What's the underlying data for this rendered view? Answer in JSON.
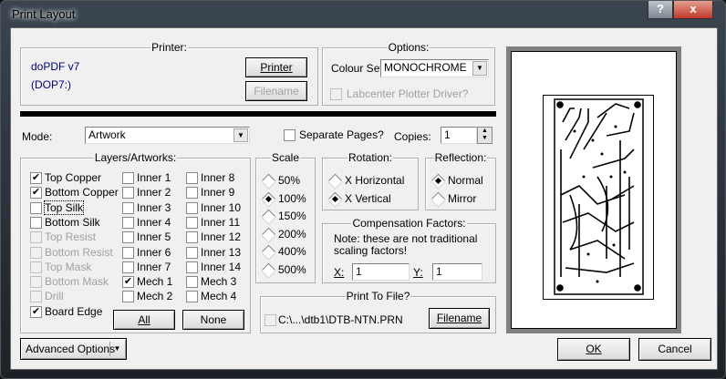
{
  "window": {
    "title": "Print Layout",
    "help": "?",
    "close": "x"
  },
  "printer": {
    "group": "Printer:",
    "name": "doPDF v7",
    "port": "(DOP7:)",
    "printer_btn": "Printer",
    "filename_btn": "Filename"
  },
  "options": {
    "group": "Options:",
    "colour_label": "Colour Set:",
    "colour_value": "MONOCHROME",
    "plotter_label": "Labcenter Plotter Driver?"
  },
  "mode": {
    "label": "Mode:",
    "value": "Artwork",
    "separate_label": "Separate Pages?",
    "copies_label": "Copies:",
    "copies_value": "1"
  },
  "layers": {
    "group": "Layers/Artworks:",
    "items": [
      {
        "label": "Top Copper",
        "checked": true,
        "disabled": false
      },
      {
        "label": "Bottom Copper",
        "checked": true,
        "disabled": false
      },
      {
        "label": "Top Silk",
        "checked": false,
        "disabled": false
      },
      {
        "label": "Bottom Silk",
        "checked": false,
        "disabled": false
      },
      {
        "label": "Top Resist",
        "checked": false,
        "disabled": true
      },
      {
        "label": "Bottom Resist",
        "checked": false,
        "disabled": true
      },
      {
        "label": "Top Mask",
        "checked": false,
        "disabled": true
      },
      {
        "label": "Bottom Mask",
        "checked": false,
        "disabled": true
      },
      {
        "label": "Drill",
        "checked": false,
        "disabled": true
      },
      {
        "label": "Board Edge",
        "checked": true,
        "disabled": false
      },
      {
        "label": "Inner 1",
        "checked": false
      },
      {
        "label": "Inner 2",
        "checked": false
      },
      {
        "label": "Inner 3",
        "checked": false
      },
      {
        "label": "Inner 4",
        "checked": false
      },
      {
        "label": "Inner 5",
        "checked": false
      },
      {
        "label": "Inner 6",
        "checked": false
      },
      {
        "label": "Inner 7",
        "checked": false
      },
      {
        "label": "Mech 1",
        "checked": true
      },
      {
        "label": "Mech 2",
        "checked": false
      },
      {
        "label": "Inner 8",
        "checked": false
      },
      {
        "label": "Inner 9",
        "checked": false
      },
      {
        "label": "Inner 10",
        "checked": false
      },
      {
        "label": "Inner 11",
        "checked": false
      },
      {
        "label": "Inner 12",
        "checked": false
      },
      {
        "label": "Inner 13",
        "checked": false
      },
      {
        "label": "Inner 14",
        "checked": false
      },
      {
        "label": "Mech 3",
        "checked": false
      },
      {
        "label": "Mech 4",
        "checked": false
      }
    ],
    "all_btn": "All",
    "none_btn": "None"
  },
  "scale": {
    "group": "Scale",
    "options": [
      "50%",
      "100%",
      "150%",
      "200%",
      "400%",
      "500%"
    ],
    "selected": "100%"
  },
  "rotation": {
    "group": "Rotation:",
    "options": [
      "X Horizontal",
      "X Vertical"
    ],
    "selected": "X Vertical"
  },
  "reflection": {
    "group": "Reflection:",
    "options": [
      "Normal",
      "Mirror"
    ],
    "selected": "Normal"
  },
  "compensation": {
    "group": "Compensation Factors:",
    "note1": "Note: these are not traditional",
    "note2": "scaling factors!",
    "x_label": "X:",
    "x_value": "1",
    "y_label": "Y:",
    "y_value": "1"
  },
  "print_to_file": {
    "group": "Print To File?",
    "path": "C:\\...\\dtb1\\DTB-NTN.PRN",
    "filename_btn": "Filename"
  },
  "footer": {
    "advanced": "Advanced Options",
    "ok": "OK",
    "cancel": "Cancel"
  }
}
